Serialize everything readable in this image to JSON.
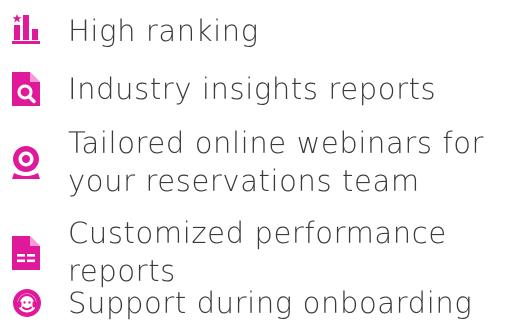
{
  "accent_color": "#e0189a",
  "features": [
    {
      "icon": "ranking-chart-icon",
      "lines": [
        "High ranking"
      ]
    },
    {
      "icon": "document-search-icon",
      "lines": [
        "Industry insights reports"
      ]
    },
    {
      "icon": "webcam-icon",
      "lines": [
        "Tailored online webinars for",
        "your reservations team"
      ]
    },
    {
      "icon": "report-document-icon",
      "lines": [
        "Customized performance",
        "reports"
      ]
    },
    {
      "icon": "support-headset-icon",
      "lines": [
        "Support during onboarding"
      ]
    }
  ]
}
